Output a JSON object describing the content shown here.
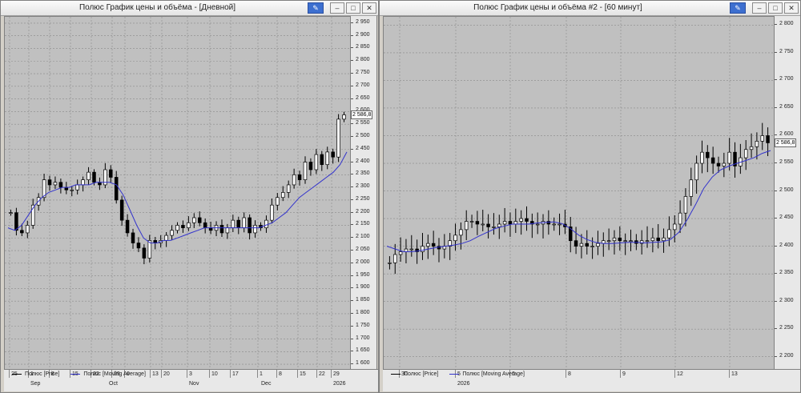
{
  "windows": [
    {
      "id": "daily",
      "title": "Полюс График цены и объёма - [Дневной]",
      "last_price": "2 586,8",
      "y_ticks": [
        "2 950",
        "2 900",
        "2 850",
        "2 800",
        "2 750",
        "2 700",
        "2 650",
        "2 600",
        "2 550",
        "2 500",
        "2 450",
        "2 400",
        "2 350",
        "2 300",
        "2 250",
        "2 200",
        "2 150",
        "2 100",
        "2 050",
        "2 000",
        "1 950",
        "1 900",
        "1 850",
        "1 800",
        "1 750",
        "1 700",
        "1 650",
        "1 600"
      ],
      "x_ticks": [
        "25",
        "1",
        "8",
        "15",
        "22",
        "29",
        "6",
        "13",
        "20",
        "3",
        "10",
        "17",
        "1",
        "8",
        "15",
        "22",
        "29"
      ],
      "x_months": [
        "Sep",
        "Oct",
        "Nov",
        "Dec",
        "2026"
      ],
      "legend": [
        "Полюс [Price]",
        "Полюс [Moving Average]"
      ]
    },
    {
      "id": "hourly",
      "title": "Полюс График цены и объёма #2 - [60 минут]",
      "last_price": "2 586,8",
      "y_ticks": [
        "2 800",
        "2 750",
        "2 700",
        "2 650",
        "2 600",
        "2 550",
        "2 500",
        "2 450",
        "2 400",
        "2 350",
        "2 300",
        "2 250",
        "2 200"
      ],
      "x_ticks": [
        "30",
        "5",
        "6",
        "8",
        "9",
        "12",
        "13"
      ],
      "x_months": [
        "2026"
      ],
      "legend": [
        "Полюс [Price]",
        "Полюс [Moving Average]"
      ]
    }
  ],
  "colors": {
    "background": "#c0c0c0",
    "grid": "#8a8a8a",
    "candle": "#000000",
    "ma_line": "#3333cc",
    "titlebar_pin": "#3d6fd0"
  },
  "icons": [
    "pin-icon",
    "minimize-icon",
    "maximize-icon",
    "close-icon"
  ],
  "chart_data": [
    {
      "type": "line",
      "title": "Полюс График цены и объёма - [Дневной]",
      "ylim": [
        1575,
        2975
      ],
      "series": [
        {
          "name": "Полюс [Price]",
          "values": [
            2200,
            2130,
            2120,
            2150,
            2230,
            2260,
            2330,
            2310,
            2320,
            2300,
            2290,
            2290,
            2310,
            2330,
            2360,
            2320,
            2310,
            2370,
            2340,
            2250,
            2170,
            2120,
            2080,
            2060,
            2020,
            2090,
            2080,
            2090,
            2110,
            2130,
            2150,
            2140,
            2160,
            2180,
            2160,
            2140,
            2130,
            2150,
            2120,
            2140,
            2170,
            2140,
            2180,
            2120,
            2150,
            2140,
            2170,
            2230,
            2260,
            2280,
            2310,
            2350,
            2330,
            2400,
            2370,
            2430,
            2390,
            2440,
            2420,
            2570,
            2587
          ]
        },
        {
          "name": "Полюс [Moving Average]",
          "values": [
            2140,
            2130,
            2150,
            2190,
            2230,
            2260,
            2280,
            2290,
            2300,
            2300,
            2310,
            2310,
            2310,
            2320,
            2320,
            2320,
            2310,
            2270,
            2210,
            2150,
            2100,
            2080,
            2080,
            2090,
            2090,
            2100,
            2110,
            2120,
            2130,
            2140,
            2140,
            2140,
            2140,
            2140,
            2140,
            2140,
            2140,
            2140,
            2150,
            2160,
            2180,
            2200,
            2230,
            2260,
            2280,
            2300,
            2320,
            2340,
            2360,
            2390,
            2440
          ]
        }
      ]
    },
    {
      "type": "line",
      "title": "Полюс График цены и объёма #2 - [60 минут]",
      "ylim": [
        2175,
        2815
      ],
      "series": [
        {
          "name": "Полюс [Price]",
          "values": [
            2370,
            2385,
            2390,
            2395,
            2395,
            2390,
            2400,
            2405,
            2400,
            2395,
            2400,
            2410,
            2420,
            2430,
            2445,
            2445,
            2440,
            2440,
            2435,
            2435,
            2440,
            2445,
            2440,
            2445,
            2450,
            2445,
            2440,
            2440,
            2445,
            2440,
            2440,
            2440,
            2435,
            2410,
            2400,
            2405,
            2400,
            2400,
            2405,
            2410,
            2410,
            2415,
            2410,
            2410,
            2410,
            2405,
            2410,
            2410,
            2415,
            2410,
            2415,
            2430,
            2440,
            2460,
            2490,
            2520,
            2550,
            2570,
            2560,
            2550,
            2545,
            2550,
            2570,
            2545,
            2560,
            2575,
            2580,
            2590,
            2600,
            2587
          ]
        },
        {
          "name": "Полюс [Moving Average]",
          "values": [
            2400,
            2395,
            2390,
            2390,
            2392,
            2395,
            2398,
            2400,
            2402,
            2405,
            2410,
            2418,
            2425,
            2432,
            2436,
            2440,
            2440,
            2440,
            2442,
            2443,
            2444,
            2441,
            2432,
            2420,
            2412,
            2407,
            2405,
            2405,
            2406,
            2407,
            2407,
            2406,
            2407,
            2408,
            2412,
            2425,
            2448,
            2475,
            2505,
            2525,
            2538,
            2545,
            2550,
            2555,
            2560,
            2568,
            2573
          ]
        }
      ]
    }
  ]
}
